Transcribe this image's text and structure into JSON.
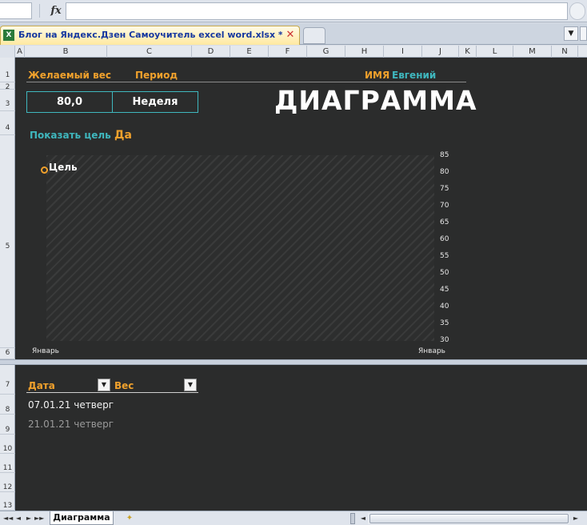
{
  "formula_bar": {
    "fx_label": "fx",
    "value": ""
  },
  "workbook_tab": {
    "icon_letter": "X",
    "title": "Блог на Яндекс.Дзен Самоучитель excel word.xlsx *",
    "close_glyph": "✕",
    "dropdown_glyph": "▼"
  },
  "columns": [
    "A",
    "B",
    "C",
    "D",
    "E",
    "F",
    "G",
    "H",
    "I",
    "J",
    "K",
    "L",
    "M",
    "N"
  ],
  "rows_top": [
    "1",
    "2",
    "3",
    "4",
    "5",
    "6"
  ],
  "rows_bottom": [
    "7",
    "8",
    "9",
    "10",
    "11",
    "12",
    "13"
  ],
  "sheet": {
    "weight_label": "Желаемый вес",
    "period_label": "Период",
    "name_label": "ИМЯ",
    "name_value": "Евгений",
    "weight_value": "80,0",
    "period_value": "Неделя",
    "title": "ДИАГРАММА",
    "show_goal_label": "Показать цель",
    "show_goal_value": "Да"
  },
  "chart_data": {
    "type": "line",
    "title": "",
    "series": [],
    "annotation": "Цель",
    "y_ticks": [
      "85",
      "80",
      "75",
      "70",
      "65",
      "60",
      "55",
      "50",
      "45",
      "40",
      "35",
      "30"
    ],
    "ylim": [
      30,
      85
    ],
    "x_tick_labels": [
      "Январь",
      "Январь"
    ],
    "grid": false,
    "colors": {
      "goal": "#f0a12c",
      "text": "#ffffff"
    }
  },
  "table": {
    "headers": [
      "Дата",
      "Вес"
    ],
    "filter_glyph": "▼",
    "rows": [
      {
        "date": "07.01.21 четверг",
        "weight": ""
      },
      {
        "date": "21.01.21 четверг",
        "weight": ""
      }
    ]
  },
  "bottom": {
    "nav": [
      "◄◄",
      "◄",
      "►",
      "►►"
    ],
    "sheet_tab": "Диаграмма",
    "scroll_left": "◄",
    "scroll_right": "►"
  },
  "colors": {
    "sheet_bg": "#2b2c2c",
    "accent_orange": "#f0a12c",
    "accent_teal": "#3fb7be"
  }
}
